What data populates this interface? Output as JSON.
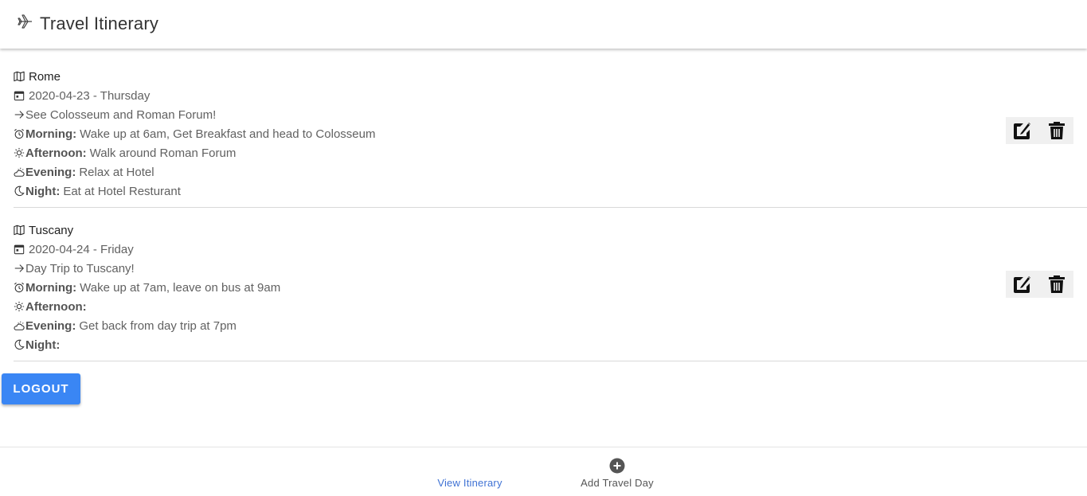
{
  "app": {
    "title": "Travel Itinerary"
  },
  "labels": {
    "morning": "Morning:",
    "afternoon": "Afternoon:",
    "evening": "Evening:",
    "night": "Night:"
  },
  "days": [
    {
      "location": "Rome",
      "date": "2020-04-23 - Thursday",
      "summary": "See Colosseum and Roman Forum!",
      "morning": "Wake up at 6am, Get Breakfast and head to Colosseum",
      "afternoon": "Walk around Roman Forum",
      "evening": "Relax at Hotel",
      "night": "Eat at Hotel Resturant"
    },
    {
      "location": "Tuscany",
      "date": "2020-04-24 - Friday",
      "summary": "Day Trip to Tuscany!",
      "morning": "Wake up at 7am, leave on bus at 9am",
      "afternoon": "",
      "evening": "Get back from day trip at 7pm",
      "night": ""
    }
  ],
  "logout_label": "LOGOUT",
  "bottom_nav": {
    "view_label": "View Itinerary",
    "add_label": "Add Travel Day"
  },
  "colors": {
    "primary": "#3a86f4",
    "nav_active": "#3f72d4",
    "action_bg": "#f0f0f0"
  },
  "icons": [
    "airplane-icon",
    "map-icon",
    "calendar-icon",
    "arrow-right-icon",
    "alarm-clock-icon",
    "sun-icon",
    "cloud-sun-icon",
    "moon-icon",
    "edit-icon",
    "trash-icon",
    "plus-circle-icon"
  ]
}
